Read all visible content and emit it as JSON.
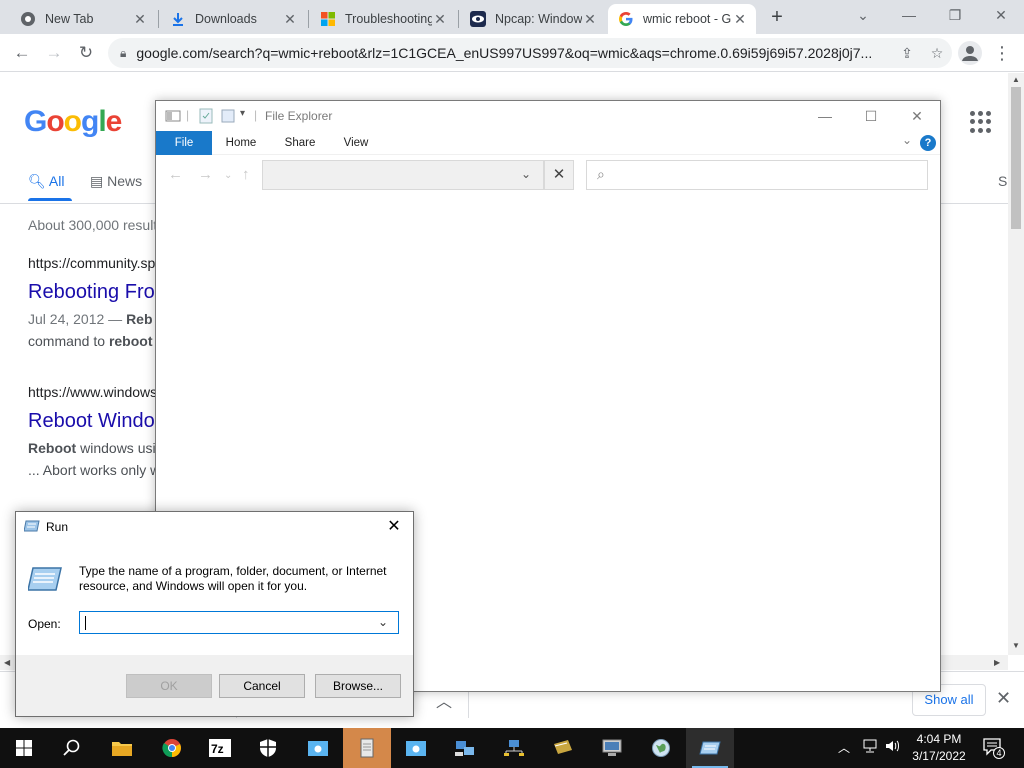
{
  "browser": {
    "tabs": [
      {
        "title": "New Tab",
        "favicon": "chrome-icon",
        "active": false
      },
      {
        "title": "Downloads",
        "favicon": "download-icon",
        "active": false
      },
      {
        "title": "Troubleshooting",
        "favicon": "microsoft-icon",
        "active": false
      },
      {
        "title": "Npcap: Window",
        "favicon": "npcap-eye-icon",
        "active": false
      },
      {
        "title": "wmic reboot - G",
        "favicon": "google-g-icon",
        "active": true
      }
    ],
    "url": "google.com/search?q=wmic+reboot&rlz=1C1GCEA_enUS997US997&oq=wmic&aqs=chrome.0.69i59j69i57.2028j0j7..."
  },
  "google": {
    "logo": "Google",
    "tabs": [
      "All",
      "News"
    ],
    "right_clip": "S",
    "stats": "About 300,000 result",
    "results": [
      {
        "url": "https://community.sp",
        "title": "Rebooting Fro",
        "snippet_date": "Jul 24, 2012 — ",
        "snippet_bold": "Reb",
        "snippet_line2_pre": "command to ",
        "snippet_line2_bold": "reboot"
      },
      {
        "url": "https://www.windows",
        "title": "Reboot Windo",
        "snippet_bold": "Reboot",
        "snippet_rest": " windows usi",
        "snippet_line2": "... Abort works only w"
      }
    ],
    "downloads_bar": {
      "show_all": "Show all"
    }
  },
  "explorer": {
    "title": "File Explorer",
    "ribbon_tabs": [
      "File",
      "Home",
      "Share",
      "View"
    ],
    "help": "?"
  },
  "run": {
    "title": "Run",
    "description": "Type the name of a program, folder, document, or Internet resource, and Windows will open it for you.",
    "open_label": "Open:",
    "open_value": "",
    "ok": "OK",
    "cancel": "Cancel",
    "browse": "Browse..."
  },
  "taskbar": {
    "time": "4:04 PM",
    "date": "3/17/2022",
    "notifications": "4",
    "apps": [
      "start-icon",
      "search-icon",
      "file-explorer-icon",
      "chrome-icon",
      "7zip-icon",
      "shield-icon",
      "folder-icon",
      "notepad-icon",
      "folder-icon",
      "network-icon",
      "network-icon",
      "server-icon",
      "computer-icon",
      "globe-icon",
      "run-icon"
    ]
  },
  "colors": {
    "accent": "#1a73e8",
    "link": "#1a0dab",
    "file_tab": "#1979ca",
    "taskbar": "#101010"
  }
}
